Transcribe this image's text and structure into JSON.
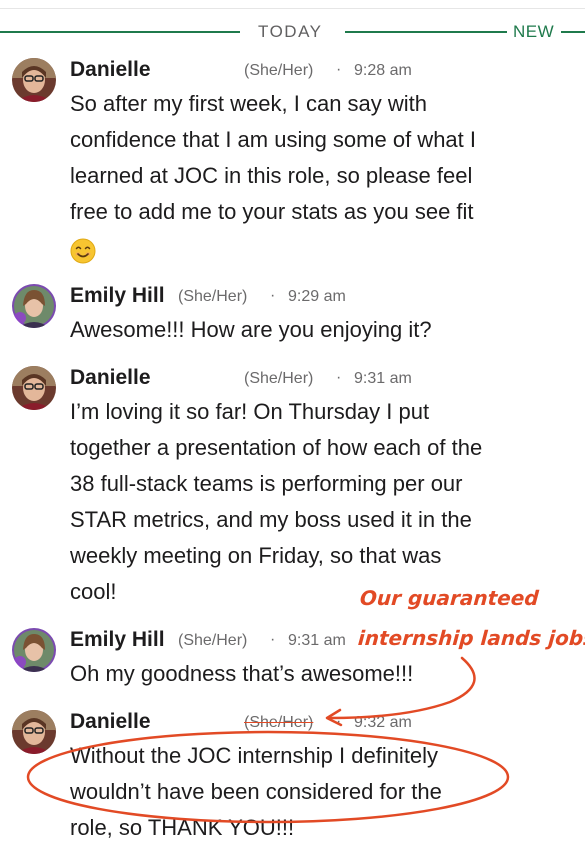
{
  "divider": {
    "today": "TODAY",
    "new": "NEW"
  },
  "messages": [
    {
      "name": "Danielle",
      "pronouns": "(She/Her)",
      "time": "9:28 am",
      "lines": [
        "So after my first week, I can say with",
        "confidence that I am using some of what I",
        "learned at JOC in this role, so please feel",
        "free to add me to your stats as you see fit"
      ],
      "emoji": "smiling-face"
    },
    {
      "name": "Emily Hill",
      "pronouns": "(She/Her)",
      "time": "9:29 am",
      "lines": [
        "Awesome!!! How are you enjoying it?"
      ]
    },
    {
      "name": "Danielle",
      "pronouns": "(She/Her)",
      "time": "9:31 am",
      "lines": [
        "I’m loving it so far!  On Thursday I put",
        "together a presentation of how each of the",
        "38 full-stack teams is performing per our",
        "STAR metrics, and my boss used it in the",
        "weekly meeting on Friday, so that was",
        "cool!"
      ]
    },
    {
      "name": "Emily Hill",
      "pronouns": "(She/Her)",
      "time": "9:31 am",
      "lines": [
        "Oh my goodness that’s awesome!!!"
      ]
    },
    {
      "name": "Danielle",
      "pronouns": "(She/Her)",
      "time": "9:32 am",
      "lines": [
        "Without the JOC internship I definitely",
        "wouldn’t have been considered for the",
        "role, so THANK YOU!!!"
      ]
    }
  ],
  "annotation": {
    "line1": "Our guaranteed",
    "line2": "internship lands jobs",
    "color": "#e24a25"
  },
  "colors": {
    "green": "#1f7a4c",
    "meta": "#6b6a6b",
    "text": "#1d1c1d"
  }
}
